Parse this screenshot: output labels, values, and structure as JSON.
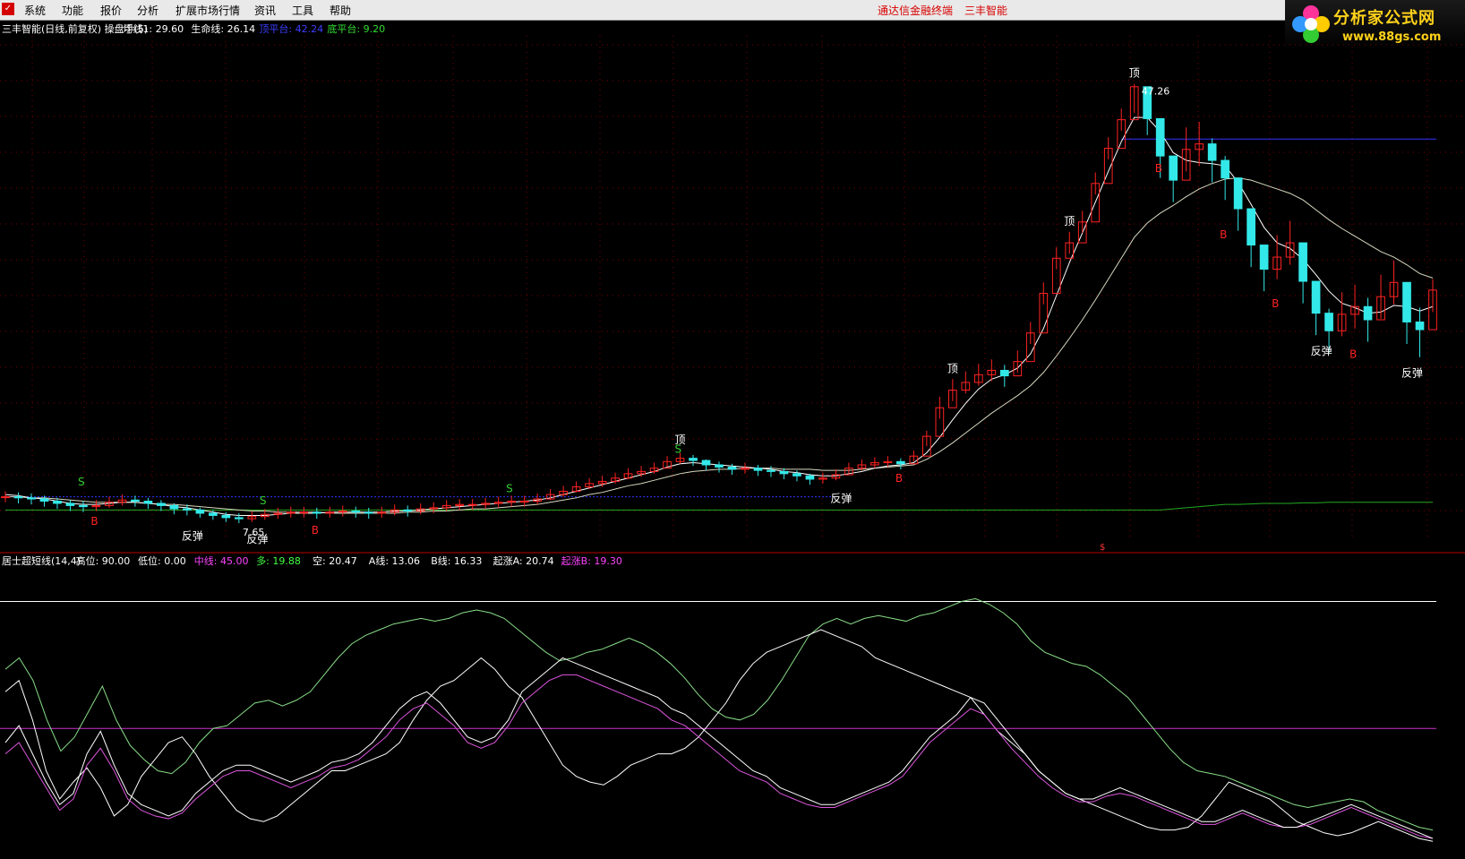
{
  "menu": {
    "items": [
      "系统",
      "功能",
      "报价",
      "分析",
      "扩展市场行情",
      "资讯",
      "工具",
      "帮助"
    ],
    "center_title": "通达信金融终端",
    "center_subtitle": "三丰智能"
  },
  "logo": {
    "title": "分析家公式网",
    "url": "www.88gs.com"
  },
  "upper_panel": {
    "header": [
      {
        "text": "三丰智能(日线,前复权) 操盘手(5)",
        "color": "#ffffff"
      },
      {
        "text": "均线1: 29.60",
        "color": "#ffffff"
      },
      {
        "text": "生命线: 26.14",
        "color": "#ffffff"
      },
      {
        "text": "顶平台: 42.24",
        "color": "#3d3dff"
      },
      {
        "text": "底平台: 9.20",
        "color": "#33dd33"
      }
    ],
    "peak_value": "47.26",
    "low_value": "7.65",
    "mark_ding": "顶",
    "mark_fantan": "反弹",
    "mark_s": "S",
    "mark_b": "B",
    "divider_marker": "$"
  },
  "lower_panel": {
    "header": [
      {
        "text": "居士超短线(14,4)",
        "color": "#ffffff"
      },
      {
        "text": "高位: 90.00",
        "color": "#ffffff"
      },
      {
        "text": "低位: 0.00",
        "color": "#ffffff"
      },
      {
        "text": "中线: 45.00",
        "color": "#ff44ff"
      },
      {
        "text": "多: 19.88",
        "color": "#44ff44"
      },
      {
        "text": "空: 20.47",
        "color": "#ffffff"
      },
      {
        "text": "A线: 13.06",
        "color": "#ffffff"
      },
      {
        "text": "B线: 16.33",
        "color": "#ffffff"
      },
      {
        "text": "起涨A: 20.74",
        "color": "#ffffff"
      },
      {
        "text": "起涨B: 19.30",
        "color": "#ff44ff"
      }
    ]
  },
  "colors": {
    "up": "#ff2222",
    "down": "#33e8e8",
    "grid": "#7a0000",
    "ma1": "#ffffff",
    "life": "#d8d8c0",
    "base": "#22aa22",
    "top_platform": "#3333ff",
    "bottom_platform": "#22aa22",
    "signal_s": "#33cc33",
    "signal_b": "#ff2222",
    "ding": "#ffffff",
    "oscillator_green": "#88dd88",
    "oscillator_white": "#ffffff",
    "oscillator_pink": "#dd55dd",
    "level_high": "#ffffff",
    "level_mid": "#cc33cc"
  },
  "chart_data": {
    "type": "candlestick",
    "symbol": "三丰智能",
    "period": "日线,前复权",
    "price_range": [
      6,
      50
    ],
    "high_level": 90,
    "low_level": 0,
    "mid_level": 45,
    "closes": [
      9.7,
      9.6,
      9.5,
      9.3,
      9.1,
      8.9,
      8.8,
      8.9,
      9.2,
      9.4,
      9.3,
      9.1,
      8.9,
      8.6,
      8.5,
      8.2,
      8.0,
      7.8,
      7.7,
      7.9,
      8.1,
      8.2,
      8.3,
      8.3,
      8.2,
      8.3,
      8.4,
      8.3,
      8.2,
      8.3,
      8.5,
      8.4,
      8.6,
      8.7,
      8.9,
      9.0,
      9.0,
      9.1,
      9.2,
      9.3,
      9.3,
      9.5,
      9.9,
      10.2,
      10.6,
      10.9,
      11.1,
      11.4,
      11.8,
      12.0,
      12.3,
      12.9,
      13.2,
      13.0,
      12.6,
      12.4,
      12.2,
      12.3,
      12.1,
      12.0,
      11.8,
      11.6,
      11.3,
      11.4,
      11.7,
      12.3,
      12.6,
      12.8,
      12.9,
      12.7,
      13.4,
      15.2,
      17.8,
      19.4,
      20.1,
      20.8,
      21.2,
      20.7,
      22.0,
      24.6,
      28.2,
      31.4,
      32.8,
      34.7,
      38.2,
      41.4,
      44.0,
      47.0,
      44.1,
      40.7,
      38.5,
      41.3,
      41.8,
      40.3,
      38.7,
      35.9,
      32.6,
      30.4,
      31.5,
      32.8,
      29.3,
      26.4,
      24.8,
      26.3,
      27.0,
      25.8,
      27.9,
      29.2,
      25.6,
      24.9,
      28.5
    ],
    "lows": [
      9.2,
      9.1,
      9.0,
      8.8,
      8.6,
      8.4,
      8.3,
      8.4,
      8.7,
      8.9,
      8.8,
      8.6,
      8.4,
      8.1,
      8.0,
      7.8,
      7.6,
      7.4,
      7.3,
      7.4,
      7.6,
      7.7,
      7.8,
      7.8,
      7.7,
      7.8,
      7.9,
      7.8,
      7.7,
      7.8,
      8.0,
      7.9,
      8.1,
      8.2,
      8.4,
      8.5,
      8.5,
      8.6,
      8.7,
      8.8,
      8.8,
      9.0,
      9.4,
      9.7,
      10.1,
      10.4,
      10.6,
      10.9,
      11.3,
      11.5,
      11.8,
      12.4,
      12.7,
      12.5,
      12.1,
      11.9,
      11.7,
      11.8,
      11.6,
      11.5,
      11.3,
      11.1,
      10.8,
      10.9,
      11.2,
      11.8,
      12.1,
      12.3,
      12.4,
      12.2,
      12.9,
      14.3,
      16.8,
      18.4,
      19.1,
      19.8,
      20.2,
      19.7,
      21.0,
      23.6,
      27.2,
      30.4,
      31.8,
      33.7,
      37.2,
      40.4,
      43.0,
      44.6,
      42.6,
      38.7,
      36.5,
      39.3,
      39.8,
      38.3,
      36.7,
      33.9,
      30.6,
      28.4,
      29.5,
      30.8,
      27.3,
      24.4,
      22.8,
      24.3,
      25.0,
      23.8,
      25.9,
      27.2,
      23.6,
      22.4,
      26.5
    ],
    "highs": [
      10.2,
      10.1,
      10.0,
      9.8,
      9.6,
      9.4,
      9.3,
      9.4,
      9.7,
      9.9,
      9.8,
      9.6,
      9.4,
      9.1,
      9.0,
      8.7,
      8.5,
      8.3,
      8.2,
      8.4,
      8.6,
      8.7,
      8.8,
      8.8,
      8.7,
      8.8,
      8.9,
      8.8,
      8.7,
      8.8,
      9.0,
      8.9,
      9.1,
      9.2,
      9.4,
      9.5,
      9.5,
      9.6,
      9.7,
      9.8,
      9.8,
      10.0,
      10.4,
      10.7,
      11.1,
      11.4,
      11.6,
      11.9,
      12.3,
      12.5,
      12.8,
      13.4,
      13.7,
      13.5,
      13.1,
      12.9,
      12.7,
      12.8,
      12.6,
      12.5,
      12.3,
      12.1,
      11.8,
      11.9,
      12.2,
      12.8,
      13.1,
      13.3,
      13.4,
      13.2,
      13.9,
      15.7,
      18.8,
      20.4,
      21.1,
      21.8,
      22.2,
      21.7,
      23.0,
      25.6,
      29.2,
      32.4,
      33.8,
      35.7,
      39.2,
      42.4,
      45.0,
      47.26,
      46.1,
      42.7,
      40.5,
      43.3,
      43.8,
      42.3,
      40.7,
      37.9,
      34.6,
      32.4,
      33.5,
      34.8,
      31.3,
      28.4,
      26.8,
      28.3,
      29.0,
      27.8,
      29.9,
      31.2,
      27.6,
      26.9,
      29.5
    ],
    "ma1": [
      9.9,
      9.8,
      9.6,
      9.5,
      9.3,
      9.1,
      9.0,
      9.0,
      9.1,
      9.2,
      9.2,
      9.1,
      9.0,
      8.8,
      8.7,
      8.5,
      8.3,
      8.1,
      8.0,
      8.0,
      8.0,
      8.1,
      8.2,
      8.2,
      8.2,
      8.3,
      8.3,
      8.3,
      8.3,
      8.3,
      8.4,
      8.4,
      8.5,
      8.6,
      8.7,
      8.8,
      8.9,
      9.0,
      9.1,
      9.2,
      9.3,
      9.4,
      9.6,
      9.9,
      10.2,
      10.5,
      10.8,
      11.1,
      11.4,
      11.7,
      12.0,
      12.4,
      12.7,
      12.8,
      12.7,
      12.6,
      12.5,
      12.4,
      12.3,
      12.2,
      12.0,
      11.9,
      11.7,
      11.6,
      11.6,
      11.8,
      12.0,
      12.3,
      12.5,
      12.6,
      12.8,
      13.7,
      15.1,
      16.7,
      18.2,
      19.5,
      20.4,
      20.8,
      21.4,
      22.7,
      25.0,
      28.0,
      31.0,
      33.7,
      36.5,
      39.3,
      42.0,
      44.2,
      44.2,
      42.9,
      41.0,
      40.3,
      40.1,
      40.0,
      39.8,
      38.3,
      36.3,
      34.2,
      32.8,
      32.3,
      31.3,
      29.9,
      28.4,
      27.3,
      26.9,
      26.4,
      26.5,
      27.1,
      27.0,
      26.6,
      27.0
    ],
    "life": [
      9.7,
      9.7,
      9.6,
      9.6,
      9.5,
      9.4,
      9.3,
      9.2,
      9.2,
      9.2,
      9.2,
      9.1,
      9.0,
      9.0,
      8.9,
      8.8,
      8.7,
      8.6,
      8.5,
      8.4,
      8.4,
      8.3,
      8.3,
      8.3,
      8.3,
      8.2,
      8.2,
      8.2,
      8.2,
      8.2,
      8.2,
      8.3,
      8.3,
      8.4,
      8.4,
      8.5,
      8.6,
      8.6,
      8.7,
      8.8,
      8.9,
      9.0,
      9.2,
      9.4,
      9.6,
      9.9,
      10.1,
      10.4,
      10.7,
      10.9,
      11.2,
      11.5,
      11.8,
      12.0,
      12.1,
      12.2,
      12.2,
      12.3,
      12.3,
      12.3,
      12.2,
      12.2,
      12.2,
      12.1,
      12.1,
      12.1,
      12.2,
      12.3,
      12.4,
      12.5,
      12.6,
      13.1,
      13.8,
      14.6,
      15.5,
      16.4,
      17.3,
      18.1,
      18.9,
      19.8,
      21.0,
      22.5,
      24.1,
      25.8,
      27.6,
      29.5,
      31.4,
      33.3,
      34.6,
      35.5,
      36.2,
      37.0,
      37.7,
      38.2,
      38.6,
      38.7,
      38.5,
      38.1,
      37.7,
      37.3,
      36.7,
      35.8,
      34.9,
      34.1,
      33.4,
      32.7,
      32.0,
      31.5,
      30.8,
      30.0,
      29.6
    ],
    "base": [
      8.5,
      8.5,
      8.5,
      8.5,
      8.5,
      8.5,
      8.5,
      8.5,
      8.5,
      8.5,
      8.5,
      8.5,
      8.5,
      8.5,
      8.5,
      8.5,
      8.5,
      8.5,
      8.5,
      8.5,
      8.5,
      8.5,
      8.5,
      8.5,
      8.5,
      8.5,
      8.5,
      8.5,
      8.5,
      8.5,
      8.5,
      8.5,
      8.5,
      8.5,
      8.5,
      8.5,
      8.5,
      8.5,
      8.5,
      8.5,
      8.5,
      8.5,
      8.5,
      8.5,
      8.5,
      8.5,
      8.5,
      8.5,
      8.5,
      8.5,
      8.5,
      8.5,
      8.5,
      8.5,
      8.5,
      8.5,
      8.5,
      8.5,
      8.5,
      8.5,
      8.5,
      8.5,
      8.5,
      8.5,
      8.5,
      8.5,
      8.5,
      8.5,
      8.5,
      8.5,
      8.5,
      8.5,
      8.5,
      8.5,
      8.5,
      8.5,
      8.5,
      8.5,
      8.5,
      8.5,
      8.5,
      8.5,
      8.5,
      8.5,
      8.5,
      8.5,
      8.5,
      8.5,
      8.5,
      8.5,
      8.6,
      8.7,
      8.8,
      8.9,
      9.0,
      9.0,
      9.05,
      9.1,
      9.1,
      9.1,
      9.15,
      9.15,
      9.2,
      9.2,
      9.2,
      9.2,
      9.2,
      9.2,
      9.2,
      9.2,
      9.2
    ],
    "osc_green": [
      66,
      70,
      62,
      48,
      37,
      42,
      51,
      60,
      48,
      39,
      34,
      30,
      29,
      33,
      40,
      45,
      46,
      50,
      54,
      55,
      53,
      55,
      58,
      64,
      70,
      75,
      78,
      80,
      82,
      83,
      84,
      83,
      84,
      86,
      87,
      86,
      84,
      80,
      76,
      72,
      69,
      70,
      72,
      73,
      75,
      77,
      75,
      72,
      68,
      63,
      57,
      52,
      49,
      48,
      50,
      55,
      62,
      70,
      78,
      82,
      84,
      82,
      84,
      85,
      84,
      83,
      85,
      86,
      88,
      90,
      91,
      89,
      86,
      82,
      76,
      72,
      70,
      68,
      67,
      64,
      60,
      56,
      50,
      44,
      38,
      33,
      30,
      29,
      28,
      26,
      24,
      22,
      20,
      18,
      17,
      18,
      19,
      20,
      19,
      16,
      14,
      12,
      10,
      9
    ],
    "osc_white1": [
      58,
      62,
      48,
      30,
      20,
      26,
      31,
      24,
      14,
      18,
      28,
      34,
      40,
      42,
      36,
      28,
      22,
      16,
      13,
      12,
      14,
      18,
      22,
      26,
      30,
      30,
      32,
      34,
      36,
      40,
      48,
      55,
      60,
      62,
      66,
      70,
      66,
      60,
      56,
      48,
      40,
      32,
      28,
      26,
      25,
      28,
      32,
      34,
      36,
      36,
      38,
      42,
      48,
      54,
      62,
      68,
      72,
      74,
      76,
      78,
      80,
      78,
      76,
      74,
      70,
      68,
      66,
      64,
      62,
      60,
      58,
      56,
      50,
      44,
      40,
      36,
      30,
      26,
      22,
      20,
      18,
      16,
      14,
      12,
      10,
      9,
      9,
      10,
      14,
      20,
      26,
      24,
      22,
      20,
      16,
      12,
      10,
      8,
      7,
      8,
      10,
      12,
      10,
      8,
      6,
      5
    ],
    "osc_white2": [
      40,
      46,
      36,
      26,
      18,
      22,
      36,
      44,
      32,
      22,
      18,
      16,
      14,
      16,
      22,
      26,
      30,
      32,
      32,
      30,
      28,
      26,
      28,
      30,
      33,
      34,
      36,
      40,
      46,
      52,
      56,
      58,
      54,
      48,
      42,
      40,
      42,
      48,
      58,
      62,
      66,
      70,
      68,
      66,
      64,
      62,
      60,
      58,
      56,
      52,
      50,
      46,
      42,
      38,
      34,
      30,
      28,
      24,
      22,
      20,
      18,
      18,
      20,
      22,
      24,
      26,
      30,
      36,
      42,
      46,
      50,
      56,
      54,
      48,
      42,
      36,
      30,
      26,
      22,
      20,
      20,
      22,
      24,
      22,
      20,
      18,
      16,
      14,
      12,
      12,
      14,
      16,
      14,
      12,
      10,
      10,
      12,
      14,
      16,
      18,
      16,
      14,
      12,
      10,
      8,
      6
    ],
    "osc_pink": [
      36,
      40,
      32,
      24,
      16,
      20,
      32,
      38,
      30,
      20,
      16,
      14,
      13,
      15,
      20,
      24,
      28,
      30,
      30,
      28,
      26,
      24,
      26,
      28,
      31,
      32,
      34,
      38,
      42,
      48,
      52,
      54,
      50,
      46,
      40,
      38,
      40,
      46,
      54,
      58,
      62,
      64,
      64,
      62,
      60,
      58,
      56,
      54,
      52,
      48,
      46,
      42,
      38,
      34,
      30,
      28,
      26,
      22,
      20,
      18,
      17,
      17,
      19,
      21,
      23,
      25,
      28,
      34,
      40,
      44,
      48,
      52,
      50,
      44,
      38,
      33,
      28,
      24,
      21,
      19,
      19,
      21,
      22,
      21,
      19,
      17,
      15,
      13,
      11,
      11,
      13,
      15,
      13,
      11,
      10,
      10,
      11,
      13,
      15,
      17,
      15,
      13,
      11,
      9,
      7,
      6
    ]
  }
}
